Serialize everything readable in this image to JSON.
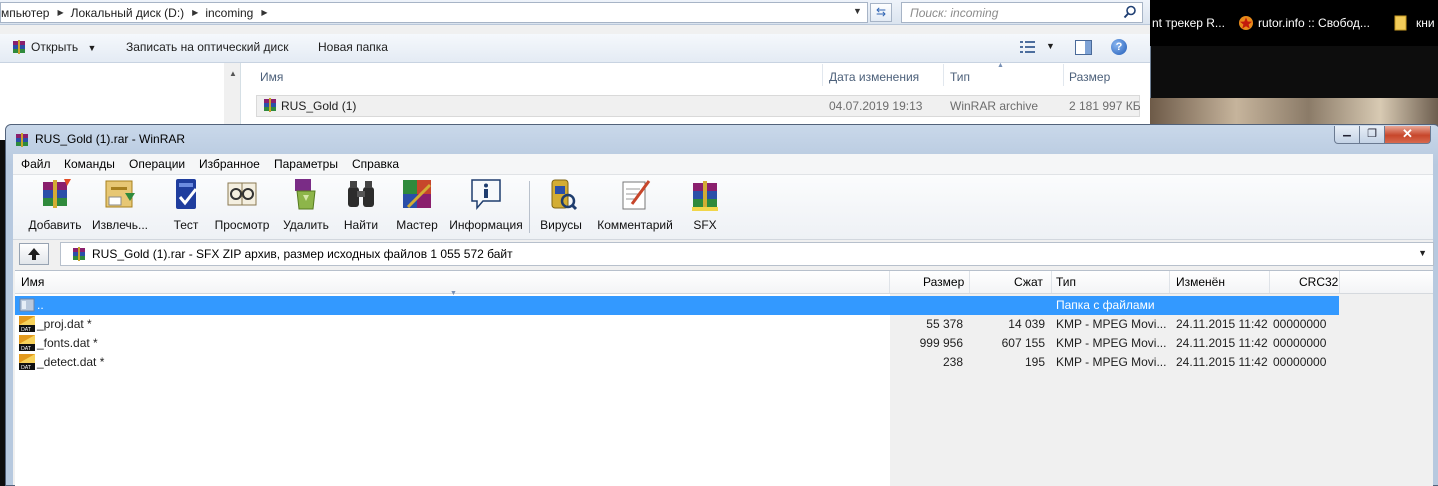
{
  "explorer": {
    "breadcrumb": [
      "мпьютер",
      "Локальный диск (D:)",
      "incoming"
    ],
    "search_placeholder": "Поиск: incoming",
    "toolbar": {
      "open_label": "Открыть",
      "burn_label": "Записать на оптический диск",
      "new_folder_label": "Новая папка"
    },
    "columns": [
      "Имя",
      "Дата изменения",
      "Тип",
      "Размер"
    ],
    "rows": [
      {
        "name": "RUS_Gold (1)",
        "date": "04.07.2019 19:13",
        "type": "WinRAR archive",
        "size": "2 181 997 КБ"
      }
    ]
  },
  "browser": {
    "bookmarks": [
      "nt трекер R...",
      "rutor.info :: Свобод...",
      "кни"
    ]
  },
  "winrar": {
    "title": "RUS_Gold (1).rar - WinRAR",
    "menu": [
      "Файл",
      "Команды",
      "Операции",
      "Избранное",
      "Параметры",
      "Справка"
    ],
    "toolbar": [
      {
        "label": "Добавить",
        "icon": "add-icon"
      },
      {
        "label": "Извлечь...",
        "icon": "extract-icon"
      },
      {
        "label": "Тест",
        "icon": "test-icon"
      },
      {
        "label": "Просмотр",
        "icon": "view-icon"
      },
      {
        "label": "Удалить",
        "icon": "delete-icon"
      },
      {
        "label": "Найти",
        "icon": "find-icon"
      },
      {
        "label": "Мастер",
        "icon": "wizard-icon"
      },
      {
        "label": "Информация",
        "icon": "info-icon"
      },
      {
        "label": "Вирусы",
        "icon": "virus-scan-icon"
      },
      {
        "label": "Комментарий",
        "icon": "comment-icon"
      },
      {
        "label": "SFX",
        "icon": "sfx-icon"
      }
    ],
    "path_text": "RUS_Gold (1).rar - SFX ZIP архив, размер исходных файлов 1 055 572 байт",
    "columns": [
      "Имя",
      "Размер",
      "Сжат",
      "Тип",
      "Изменён",
      "CRC32"
    ],
    "rows": [
      {
        "name": "..",
        "size": "",
        "packed": "",
        "type": "Папка с файлами",
        "modified": "",
        "crc": "",
        "selected": true
      },
      {
        "name": "_proj.dat *",
        "size": "55 378",
        "packed": "14 039",
        "type": "KMP - MPEG Movi...",
        "modified": "24.11.2015 11:42",
        "crc": "00000000"
      },
      {
        "name": "_fonts.dat *",
        "size": "999 956",
        "packed": "607 155",
        "type": "KMP - MPEG Movi...",
        "modified": "24.11.2015 11:42",
        "crc": "00000000"
      },
      {
        "name": "_detect.dat *",
        "size": "238",
        "packed": "195",
        "type": "KMP - MPEG Movi...",
        "modified": "24.11.2015 11:42",
        "crc": "00000000"
      }
    ]
  }
}
